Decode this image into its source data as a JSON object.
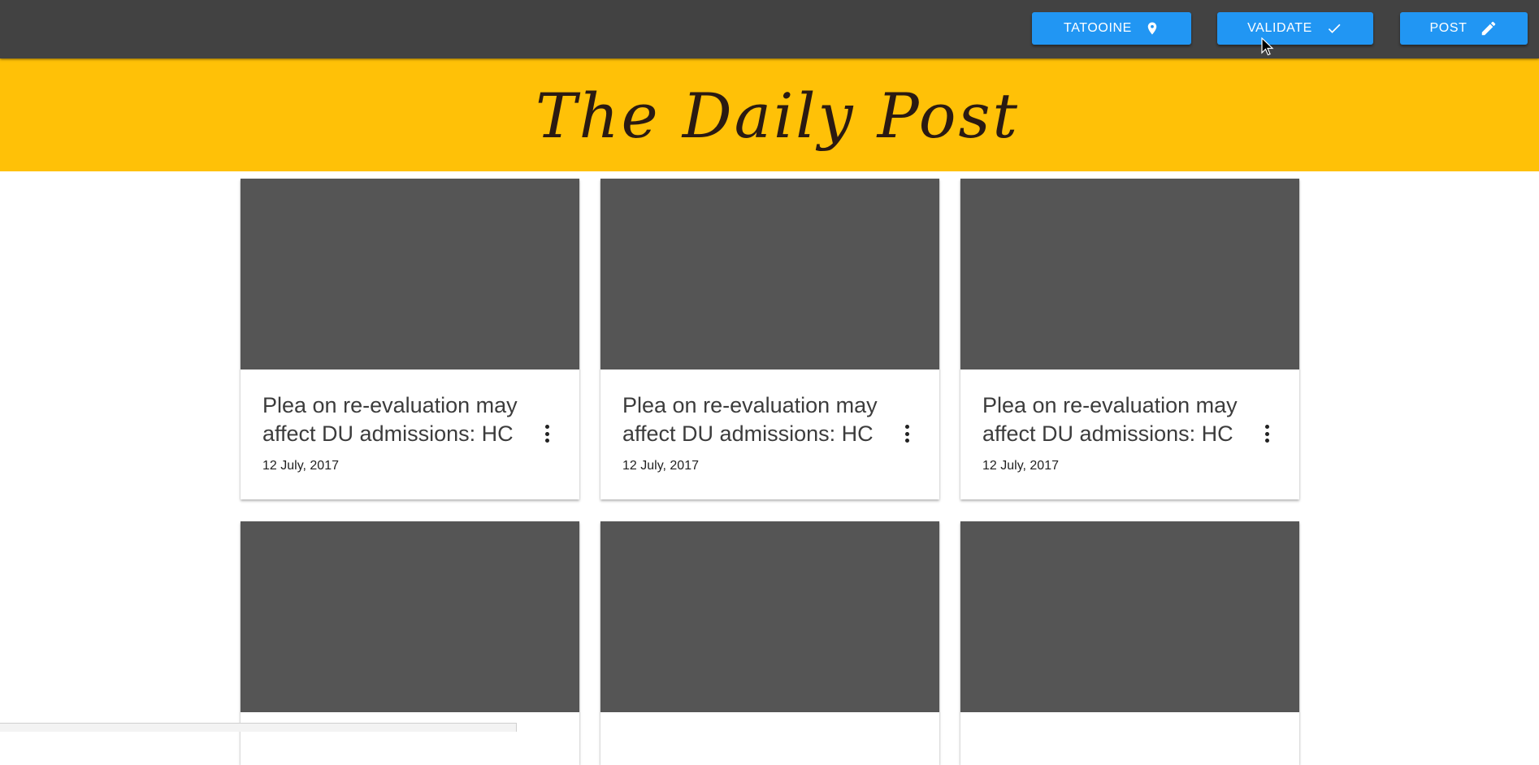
{
  "toolbar": {
    "buttons": [
      {
        "label": "TATOOINE",
        "icon": "map-marker-icon"
      },
      {
        "label": "VALIDATE",
        "icon": "check-icon"
      },
      {
        "label": "POST",
        "icon": "pencil-icon"
      }
    ]
  },
  "banner": {
    "title": "The Daily Post"
  },
  "cards": [
    {
      "title": "Plea on re-evaluation may affect DU admissions: HC",
      "date": "12 July, 2017",
      "menu_icon": "more-vert-icon"
    },
    {
      "title": "Plea on re-evaluation may affect DU admissions: HC",
      "date": "12 July, 2017",
      "menu_icon": "more-vert-icon"
    },
    {
      "title": "Plea on re-evaluation may affect DU admissions: HC",
      "date": "12 July, 2017",
      "menu_icon": "more-vert-icon"
    },
    {
      "title": "",
      "date": ""
    },
    {
      "title": "",
      "date": ""
    },
    {
      "title": "",
      "date": ""
    }
  ],
  "colors": {
    "topbar": "#424242",
    "button": "#2196F3",
    "banner": "#FFC107",
    "card_media": "#555555"
  }
}
